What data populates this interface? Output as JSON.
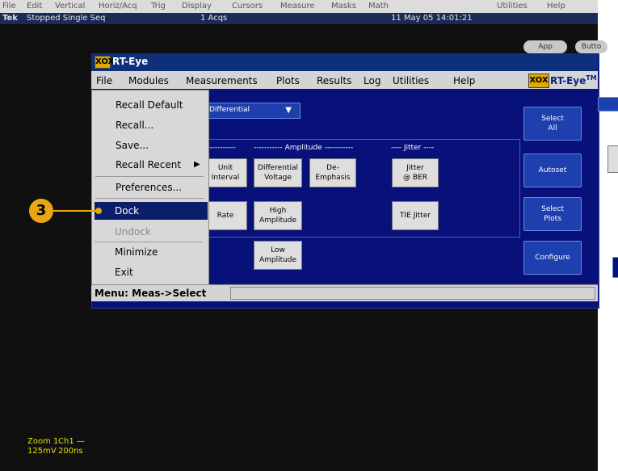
{
  "scope_menubar": [
    "File",
    "Edit",
    "Vertical",
    "Horiz/Acq",
    "Trig",
    "Display",
    "Cursors",
    "Measure",
    "Masks",
    "Math",
    "Utilities",
    "Help"
  ],
  "status_line": {
    "brand": "Tek",
    "state": "Stopped Single Seq",
    "acqs": "1 Acqs",
    "datetime": "11 May 05 14:01:21",
    "btn_app": "App",
    "btn_buttons": "Butto"
  },
  "readout": {
    "zoom": "Zoom 1",
    "ch": "Ch1 —",
    "volts": "125mV",
    "time": "200ns"
  },
  "app": {
    "logo": "XOX",
    "title": "RT-Eye",
    "menus": [
      "File",
      "Modules",
      "Measurements",
      "Plots",
      "Results",
      "Log",
      "Utilities",
      "Help"
    ],
    "brand_text": "RT-Eye",
    "brand_tm": "TM",
    "signal_type": "Differential",
    "group_labels": {
      "left": "-----------",
      "amplitude": "----------- Amplitude -----------",
      "jitter": "---- Jitter ----"
    },
    "buttons": {
      "unit_interval": [
        "Unit",
        "Interval"
      ],
      "rate": "Rate",
      "differential_voltage": [
        "Differential",
        "Voltage"
      ],
      "de_emphasis": [
        "De-",
        "Emphasis"
      ],
      "jitter_ber": [
        "Jitter",
        "@ BER"
      ],
      "high_amplitude": [
        "High",
        "Amplitude"
      ],
      "tie_jitter": "TIE Jitter",
      "low_amplitude": [
        "Low",
        "Amplitude"
      ],
      "select_all": [
        "Select",
        "All"
      ],
      "autoset": "Autoset",
      "select_plots": [
        "Select",
        "Plots"
      ],
      "configure": "Configure"
    },
    "status_text": "Menu: Meas->Select"
  },
  "file_menu": {
    "items": [
      "Recall Default",
      "Recall...",
      "Save...",
      "Recall Recent",
      "Preferences...",
      "Dock",
      "Undock",
      "Minimize",
      "Exit"
    ],
    "selected": "Dock",
    "disabled": [
      "Undock"
    ]
  },
  "callout": "3"
}
